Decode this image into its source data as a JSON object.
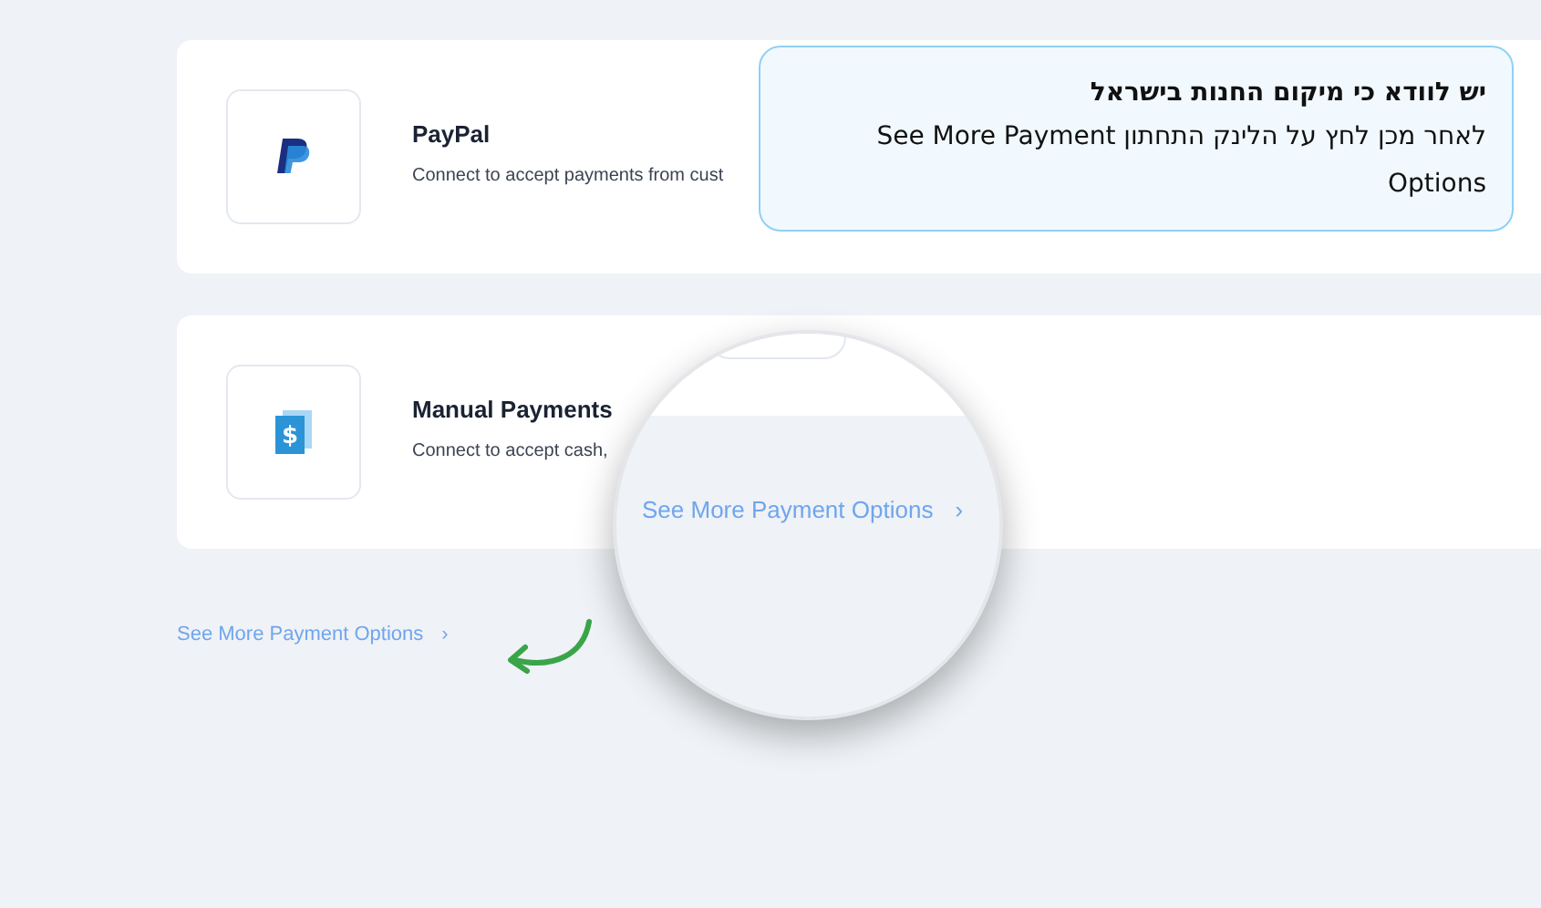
{
  "providers": [
    {
      "kind": "paypal",
      "name": "PayPal",
      "description": "Connect to accept payments from cust"
    },
    {
      "kind": "manual",
      "icon_text": "$",
      "name": "Manual Payments",
      "description": "Connect to accept cash,"
    }
  ],
  "more_link": {
    "label": "See More Payment Options",
    "chevron": "›"
  },
  "magnifier": {
    "label": "See More Payment Options",
    "chevron": "›"
  },
  "callout": {
    "title": "יש לוודא כי מיקום החנות בישראל",
    "body": "לאחר מכן לחץ על הלינק התחתון See More Payment Options"
  }
}
